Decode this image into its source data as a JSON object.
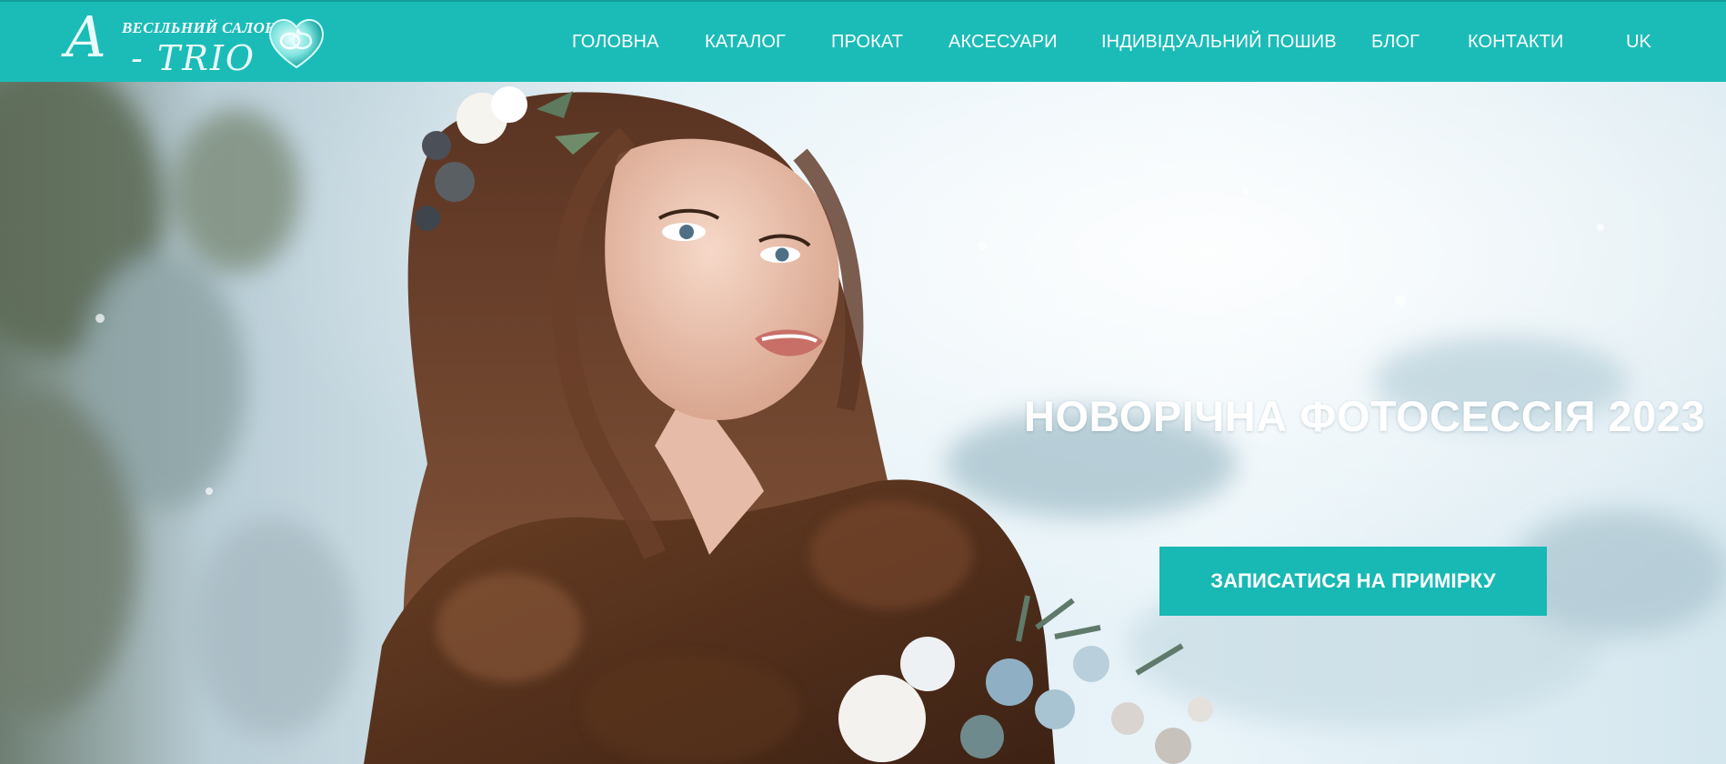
{
  "brand": {
    "letter": "A",
    "salon": "ВЕСІЛЬНИЙ САЛОН",
    "name": "- TRIO",
    "emblem_icon": "wedding-rings-heart-icon"
  },
  "nav": {
    "items": [
      {
        "label": "ГОЛОВНА"
      },
      {
        "label": "КАТАЛОГ"
      },
      {
        "label": "ПРОКАТ"
      },
      {
        "label": "АКСЕСУАРИ"
      },
      {
        "label": "ІНДИВІДУАЛЬНИЙ ПОШИВ"
      },
      {
        "label": "БЛОГ"
      },
      {
        "label": "КОНТАКТИ"
      }
    ],
    "language": "UK"
  },
  "hero": {
    "title": "НОВОРІЧНА ФОТОСЕССІЯ 2023",
    "cta_label": "ЗАПИСАТИСЯ НА ПРИМІРКУ"
  },
  "colors": {
    "accent": "#1bbcb8",
    "text_on_accent": "#ffffff"
  }
}
